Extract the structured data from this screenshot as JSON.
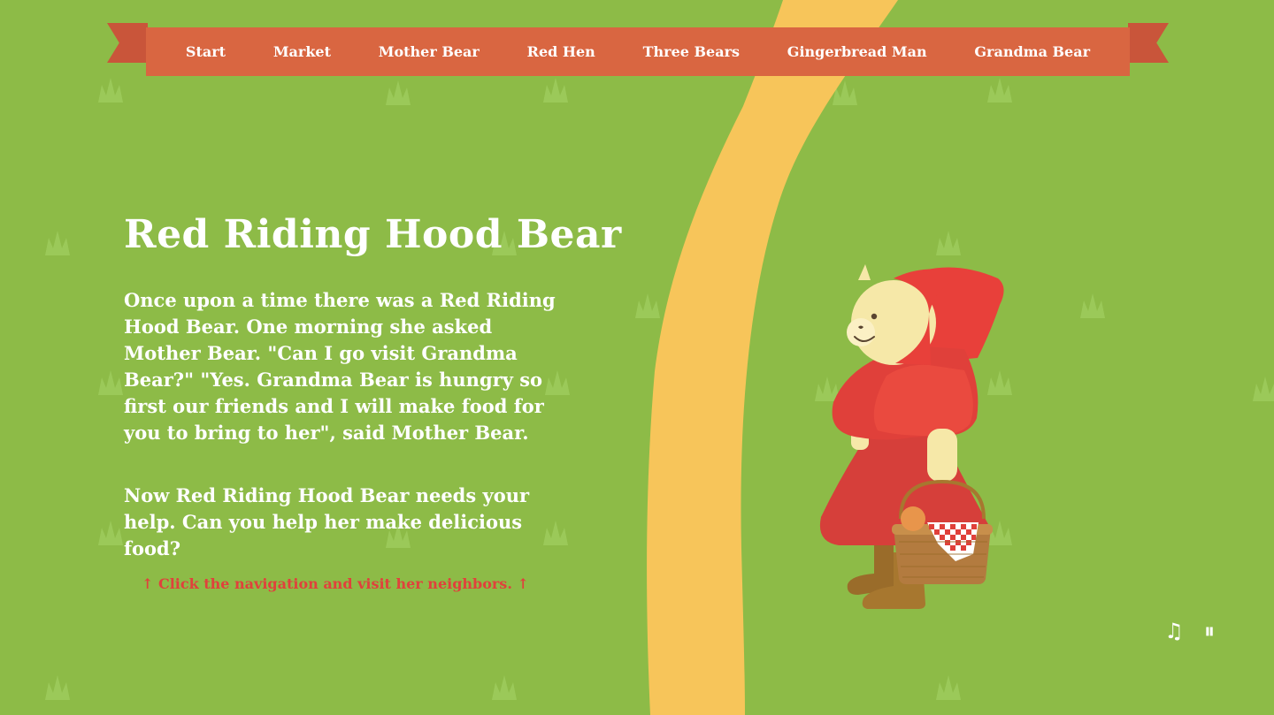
{
  "nav": {
    "items": [
      {
        "label": "Start"
      },
      {
        "label": "Market"
      },
      {
        "label": "Mother Bear"
      },
      {
        "label": "Red Hen"
      },
      {
        "label": "Three Bears"
      },
      {
        "label": "Gingerbread Man"
      },
      {
        "label": "Grandma Bear"
      }
    ]
  },
  "main": {
    "title": "Red Riding Hood Bear",
    "paragraph1": "Once upon a time there was a Red Riding Hood Bear. One morning she asked Mother Bear. \"Can I go visit Grandma Bear?\" \"Yes. Grandma Bear is hungry so first our friends and I will make food for you to bring to her\", said Mother Bear.",
    "paragraph2": "Now Red Riding Hood Bear needs your help. Can you help her make delicious food?",
    "hint": "↑ Click the navigation and visit her neighbors. ↑"
  },
  "controls": {
    "music_icon": "music-note-icon",
    "music_glyph": "♫",
    "pause_icon": "pause-icon",
    "pause_glyph": "⏸"
  },
  "colors": {
    "background": "#8dbb47",
    "ribbon": "#d96641",
    "path": "#f7c55a",
    "hint": "#e0413c"
  }
}
